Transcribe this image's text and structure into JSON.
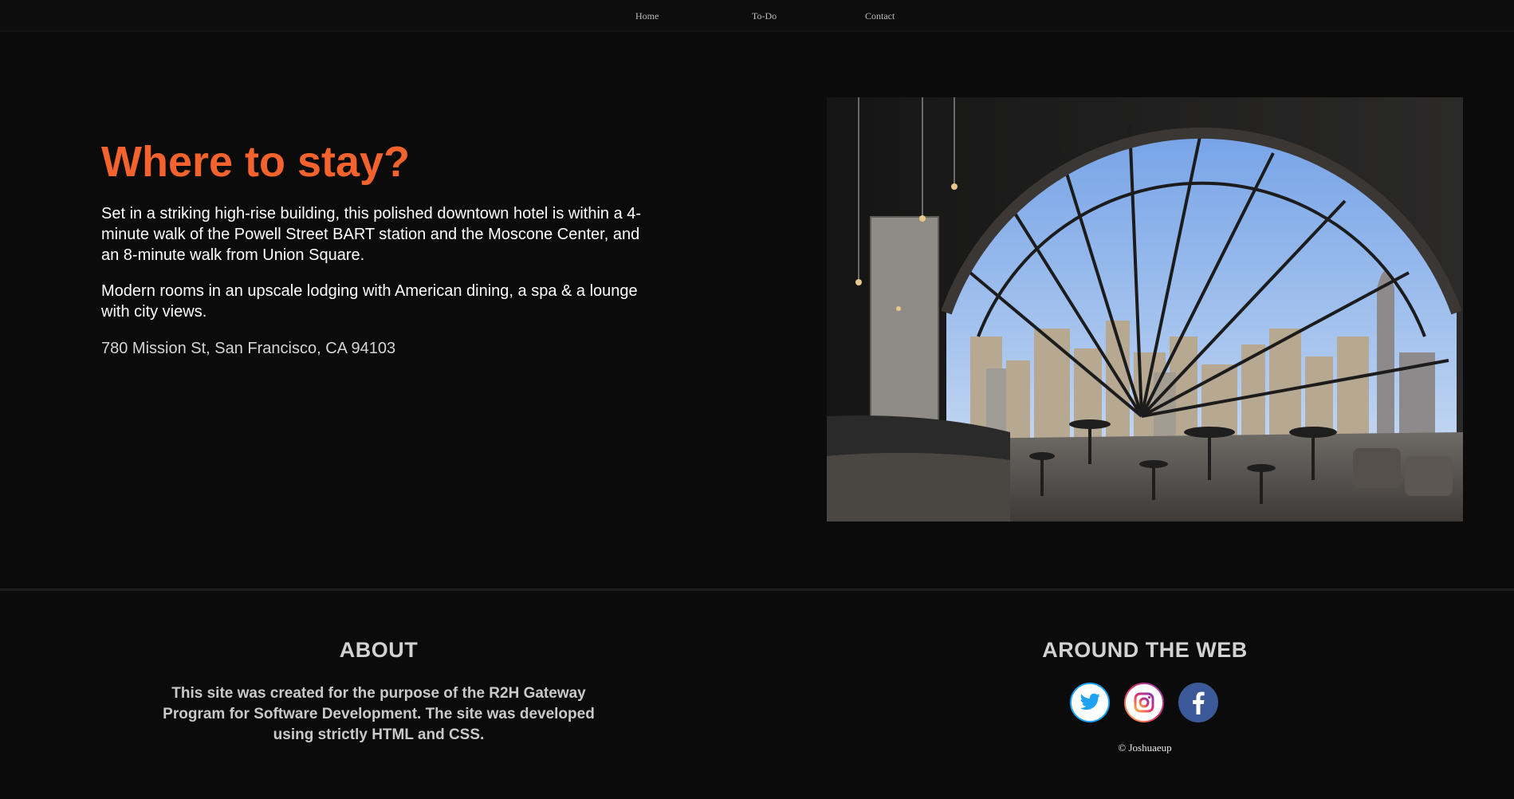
{
  "nav": {
    "home": "Home",
    "todo": "To-Do",
    "contact": "Contact"
  },
  "hero": {
    "title": "Where to stay?",
    "paragraph1": "Set in a striking high-rise building, this polished downtown hotel is within a 4-minute walk of the Powell Street BART station and the Moscone Center, and an 8-minute walk from Union Square.",
    "paragraph2": "Modern rooms in an upscale lodging with American dining, a spa & a lounge with city views.",
    "address": "780 Mission St, San Francisco, CA 94103"
  },
  "footer": {
    "about_heading": "ABOUT",
    "about_text": "This site was created for the purpose of the R2H Gateway Program for Software Development. The site was developed using strictly HTML and CSS.",
    "web_heading": "AROUND THE WEB",
    "social_icons": [
      "twitter-icon",
      "instagram-icon",
      "facebook-icon"
    ],
    "copyright": "© Joshuaeup"
  },
  "colors": {
    "accent": "#f4622d",
    "background": "#0b0b0b",
    "twitter": "#1da1f2",
    "facebook": "#3b5998"
  }
}
